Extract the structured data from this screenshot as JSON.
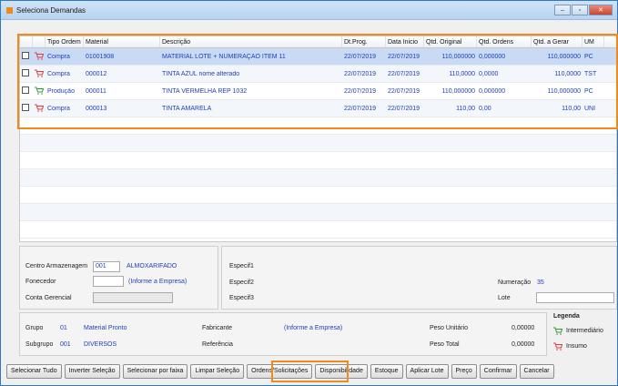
{
  "window": {
    "title": "Seleciona Demandas",
    "controls": [
      "minimize",
      "maximize",
      "close"
    ]
  },
  "grid": {
    "columns": [
      "Tipo Ordem",
      "Material",
      "Descrição",
      "Dt.Prog.",
      "Data Inicio",
      "Qtd. Original",
      "Qtd. Ordens",
      "Qtd. a Gerar",
      "UM"
    ],
    "rows": [
      {
        "tipo": "Compra",
        "material": "01001908",
        "descricao": "MATERIAL LOTE + NUMERAÇÃO ITEM 11",
        "dt_prog": "22/07/2019",
        "data_inicio": "22/07/2019",
        "qtd_original": "110,000000",
        "qtd_ordens": "0,000000",
        "qtd_gerar": "110,000000",
        "um": "PC",
        "icon": "red-cart-icon",
        "selected": true
      },
      {
        "tipo": "Compra",
        "material": "000012",
        "descricao": "TINTA AZUL nome alterado",
        "dt_prog": "22/07/2019",
        "data_inicio": "22/07/2019",
        "qtd_original": "110,0000",
        "qtd_ordens": "0,0000",
        "qtd_gerar": "110,0000",
        "um": "TST",
        "icon": "red-cart-icon",
        "selected": false
      },
      {
        "tipo": "Produção",
        "material": "000011",
        "descricao": "TINTA VERMELHA REP 1032",
        "dt_prog": "22/07/2019",
        "data_inicio": "22/07/2019",
        "qtd_original": "110,000000",
        "qtd_ordens": "0,000000",
        "qtd_gerar": "110,000000",
        "um": "PC",
        "icon": "green-cart-icon",
        "selected": false
      },
      {
        "tipo": "Compra",
        "material": "000013",
        "descricao": "TINTA AMARELA",
        "dt_prog": "22/07/2019",
        "data_inicio": "22/07/2019",
        "qtd_original": "110,00",
        "qtd_ordens": "0,00",
        "qtd_gerar": "110,00",
        "um": "UNI",
        "icon": "red-cart-icon",
        "selected": false
      }
    ]
  },
  "form": {
    "centro_label": "Centro Armazenagem",
    "centro_value": "001",
    "centro_desc": "ALMOXARIFADO",
    "fornecedor_label": "Fonecedor",
    "fornecedor_value": "",
    "fornecedor_desc": "(Informe a Empresa)",
    "conta_label": "Conta Gerencial",
    "conta_value": "",
    "especif1": "Especif1",
    "especif2": "Especif2",
    "especif3": "Especif3",
    "numeracao_label": "Numeração",
    "numeracao_value": "35",
    "lote_label": "Lote",
    "lote_value": ""
  },
  "info": {
    "grupo_label": "Grupo",
    "grupo_code": "01",
    "grupo_desc": "Material Pronto",
    "subgrupo_label": "Subgrupo",
    "subgrupo_code": "001",
    "subgrupo_desc": "DIVERSOS",
    "fabricante_label": "Fabricante",
    "fabricante_value": "(Informe a Empresa)",
    "referencia_label": "Referência",
    "peso_unit_label": "Peso Unitário",
    "peso_unit_value": "0,00000",
    "peso_total_label": "Peso Total",
    "peso_total_value": "0,00000"
  },
  "legend": {
    "title": "Legenda",
    "items": [
      "Intermediário",
      "Insumo"
    ]
  },
  "buttons": [
    "Selecionar Tudo",
    "Inverter Seleção",
    "Selecionar por faixa",
    "Limpar Seleção",
    "Ordens/Solicitações",
    "Disponibilidade",
    "Estoque",
    "Aplicar Lote",
    "Preço",
    "Confirmar",
    "Cancelar"
  ],
  "colors": {
    "highlight": "#f08a1a",
    "selected_row": "#c8daf4",
    "link_text": "#1f3fb8",
    "compra_cart": "#e03a3a",
    "producao_cart": "#2f9a3a"
  }
}
